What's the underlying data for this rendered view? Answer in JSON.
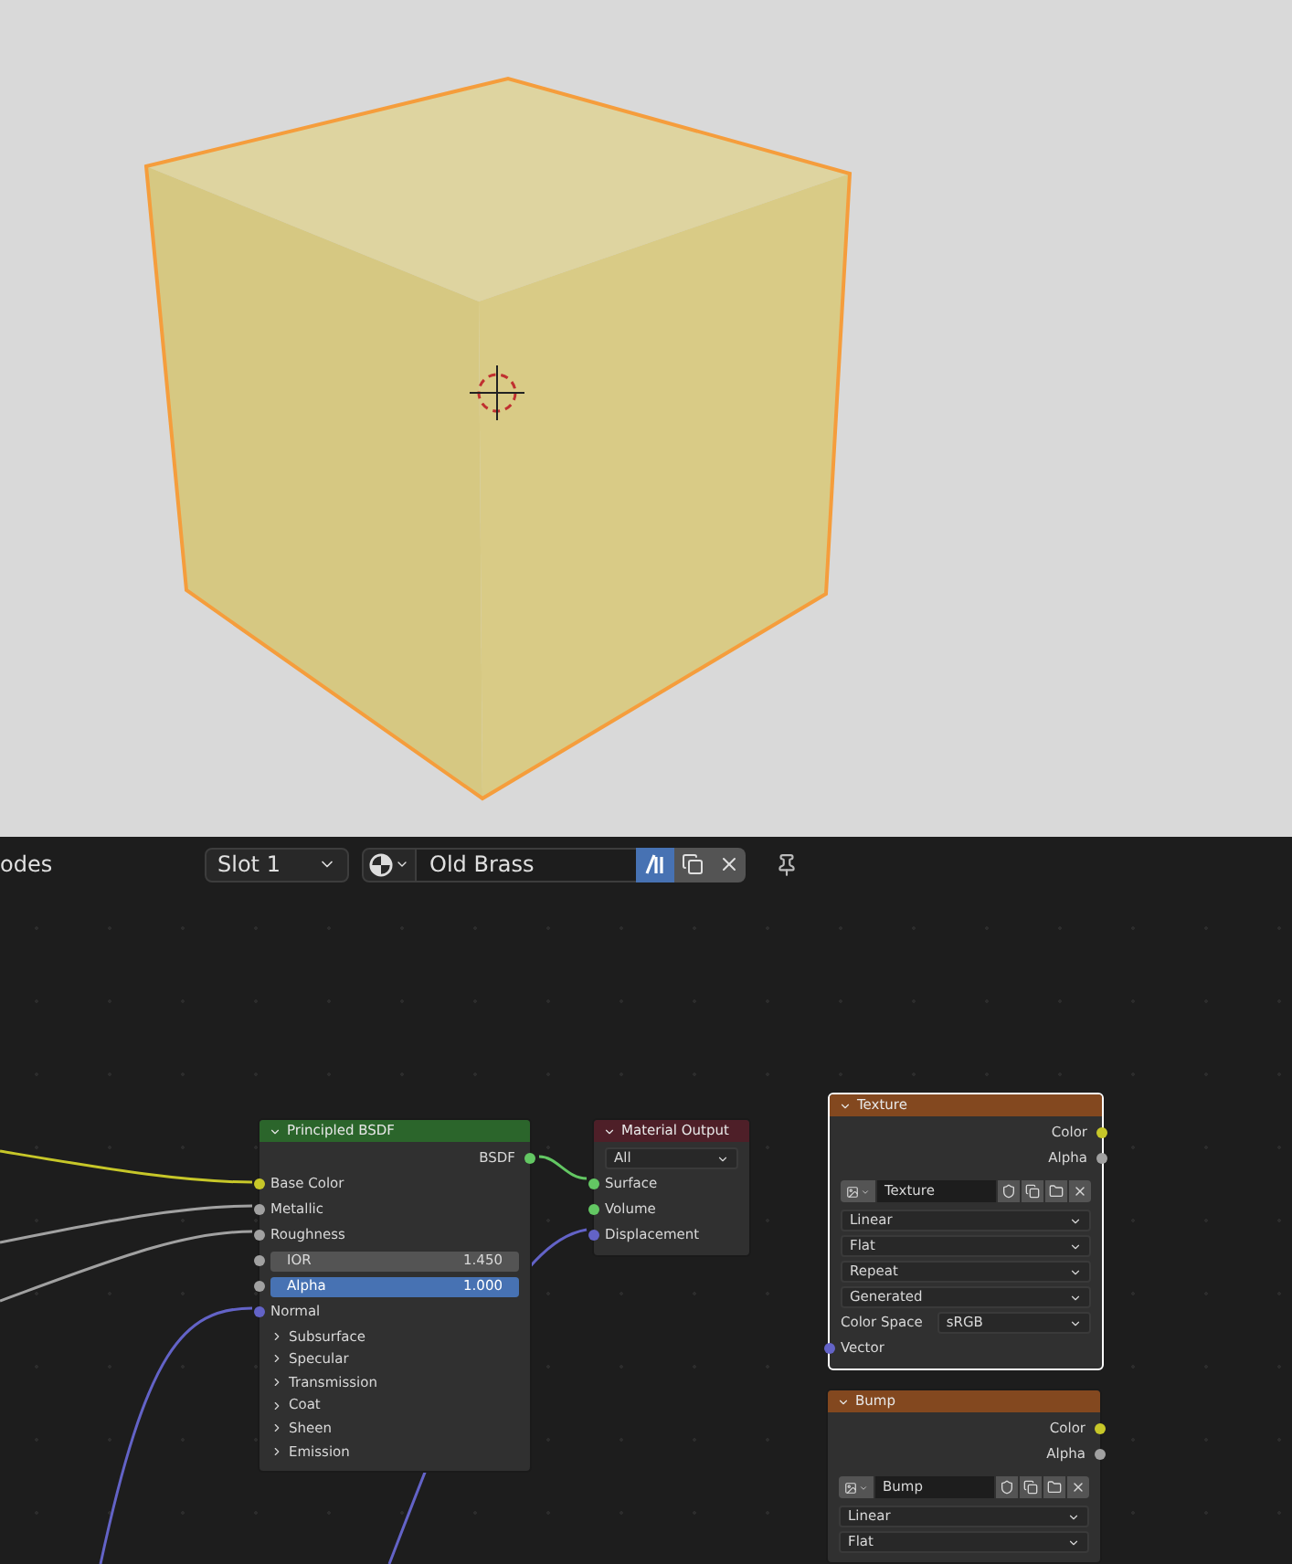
{
  "header": {
    "editor_label": "odes",
    "slot": "Slot 1",
    "material": "Old Brass",
    "link_toggle_on": true
  },
  "nodes": [
    {
      "title": "Principled BSDF",
      "color": "#2b652b",
      "selected": false,
      "rows": [
        {
          "kind": "output",
          "label": "BSDF",
          "color": "#63c763"
        },
        {
          "kind": "input",
          "label": "Base Color",
          "color": "#c7c729"
        },
        {
          "kind": "input",
          "label": "Metallic",
          "color": "#a1a1a1"
        },
        {
          "kind": "input",
          "label": "Roughness",
          "color": "#a1a1a1"
        },
        {
          "kind": "slider",
          "label": "IOR",
          "value": "1.450",
          "color": "#a1a1a1",
          "selected": false
        },
        {
          "kind": "slider",
          "label": "Alpha",
          "value": "1.000",
          "color": "#a1a1a1",
          "selected": true
        },
        {
          "kind": "input",
          "label": "Normal",
          "color": "#6363c7"
        },
        {
          "kind": "panel",
          "label": "Subsurface"
        },
        {
          "kind": "panel",
          "label": "Specular"
        },
        {
          "kind": "panel",
          "label": "Transmission"
        },
        {
          "kind": "panel",
          "label": "Coat"
        },
        {
          "kind": "panel",
          "label": "Sheen"
        },
        {
          "kind": "panel",
          "label": "Emission"
        }
      ]
    },
    {
      "title": "Material Output",
      "color": "#4e1f28",
      "selected": false,
      "rows": [
        {
          "kind": "dropdown",
          "value": "All"
        },
        {
          "kind": "input",
          "label": "Surface",
          "color": "#63c763"
        },
        {
          "kind": "input",
          "label": "Volume",
          "color": "#63c763"
        },
        {
          "kind": "input",
          "label": "Displacement",
          "color": "#6363c7"
        }
      ]
    },
    {
      "title": "Texture",
      "color": "#83481f",
      "selected": true,
      "rows": [
        {
          "kind": "output",
          "label": "Color",
          "color": "#c7c729"
        },
        {
          "kind": "output",
          "label": "Alpha",
          "color": "#a1a1a1"
        },
        {
          "kind": "image",
          "value": "Texture"
        },
        {
          "kind": "dropdown",
          "value": "Linear"
        },
        {
          "kind": "dropdown",
          "value": "Flat"
        },
        {
          "kind": "dropdown",
          "value": "Repeat"
        },
        {
          "kind": "dropdown",
          "value": "Generated"
        },
        {
          "kind": "labeled_dropdown",
          "label": "Color Space",
          "value": "sRGB"
        },
        {
          "kind": "input",
          "label": "Vector",
          "color": "#6363c7"
        }
      ]
    },
    {
      "title": "Bump",
      "color": "#83481f",
      "selected": false,
      "rows": [
        {
          "kind": "output",
          "label": "Color",
          "color": "#c7c729"
        },
        {
          "kind": "output",
          "label": "Alpha",
          "color": "#a1a1a1"
        },
        {
          "kind": "image",
          "value": "Bump"
        },
        {
          "kind": "dropdown",
          "value": "Linear"
        },
        {
          "kind": "dropdown",
          "value": "Flat"
        }
      ]
    }
  ]
}
